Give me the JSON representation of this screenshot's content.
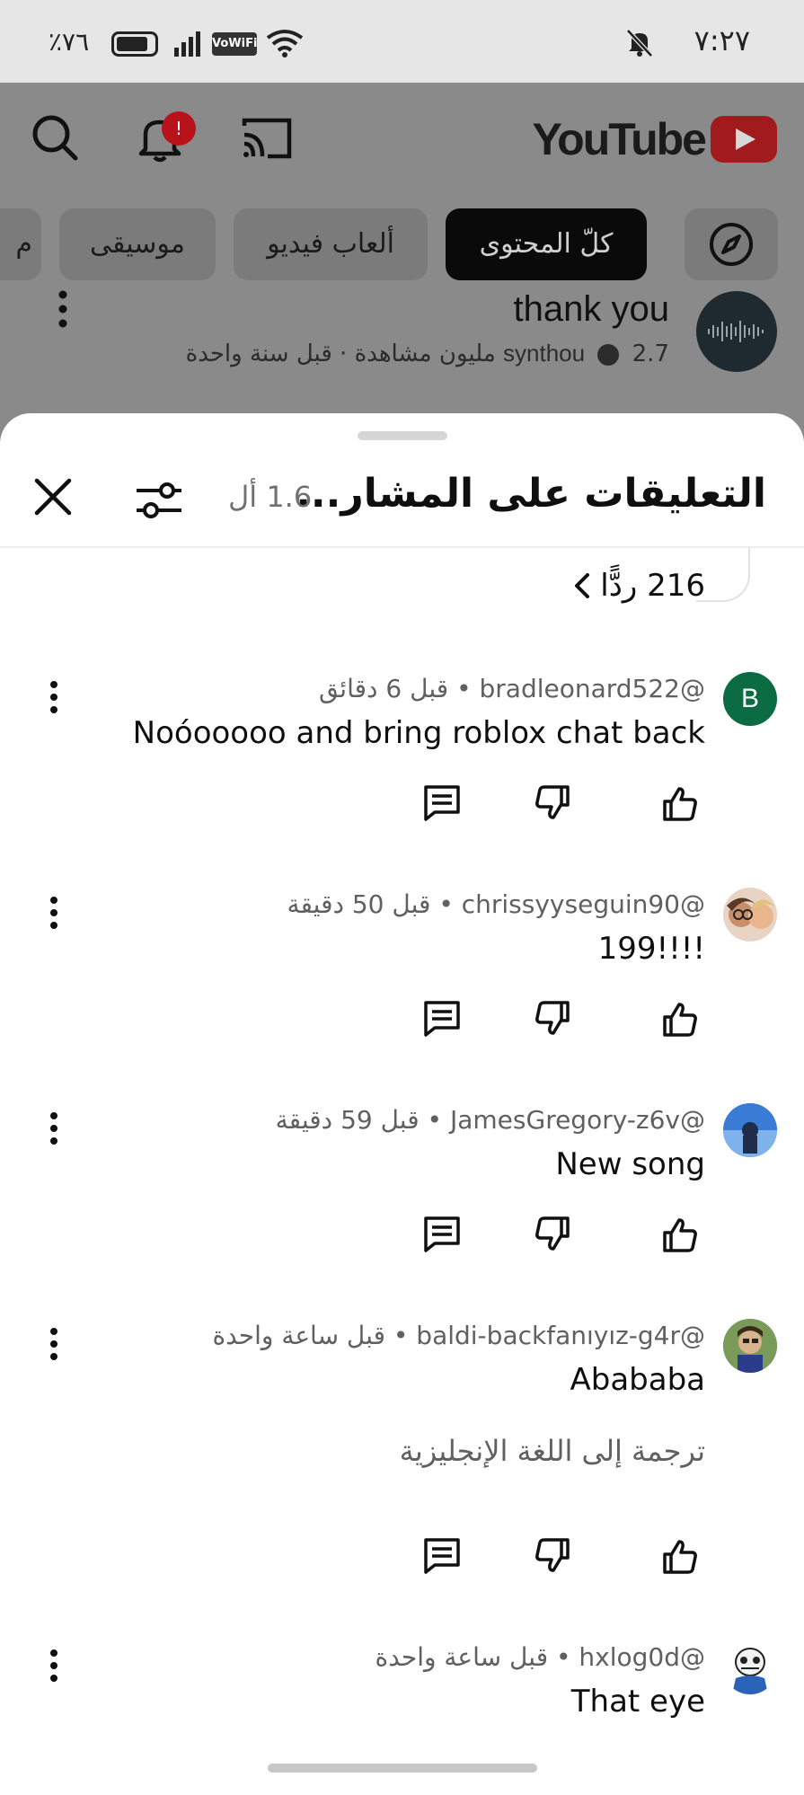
{
  "status_bar": {
    "time": "٧:٢٧",
    "battery_percent": "٪٧٦",
    "vowifi": "VoWiFi",
    "icons": [
      "mute-bell-icon",
      "battery-icon",
      "signal-icon",
      "wifi-icon"
    ]
  },
  "background_app": {
    "logo_text": "YouTube",
    "notification_count": "!",
    "chips": [
      "كلّ المحتوى",
      "ألعاب فيديو",
      "موسيقى",
      "م"
    ],
    "video": {
      "title": "thank you",
      "channel": "synthou",
      "meta": "2.7 مليون مشاهدة · قبل سنة واحدة"
    }
  },
  "sheet": {
    "title": "التعليقات على المشار...",
    "count": "1.6 أل",
    "replies_label": "216 ردًّا"
  },
  "comments": [
    {
      "author": "@bradleonard522",
      "time": "قبل 6 دقائق",
      "text": "Noóooooo and bring roblox chat back",
      "avatar_letter": "B",
      "avatar_color": "#0b6b42"
    },
    {
      "author": "@chrissyyseguin90",
      "time": "قبل 50 دقيقة",
      "text": "199!!!!"
    },
    {
      "author": "@JamesGregory-z6v",
      "time": "قبل 59 دقيقة",
      "text": "New song"
    },
    {
      "author": "@baldi-backfanıyız-g4r",
      "time": "قبل ساعة واحدة",
      "text": "Abababa",
      "translate": "ترجمة إلى اللغة الإنجليزية"
    },
    {
      "author": "@hxlog0d",
      "time": "قبل ساعة واحدة",
      "text": "That eye"
    }
  ],
  "colors": {
    "accent_red": "#b8121a",
    "text_primary": "#0f0f0f",
    "text_secondary": "#606060"
  }
}
